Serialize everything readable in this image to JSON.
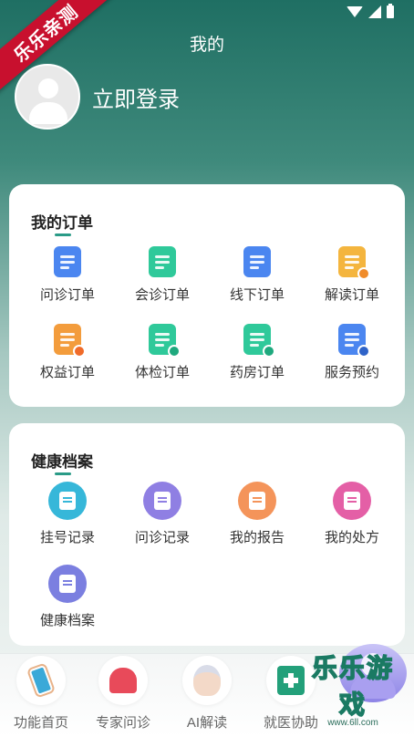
{
  "ribbon": "乐乐亲测",
  "page_title": "我的",
  "login_label": "立即登录",
  "orders": {
    "title": "我的订单",
    "items": [
      {
        "label": "问诊订单",
        "icon": "clipboard-icon",
        "color": "#4b86f0"
      },
      {
        "label": "会诊订单",
        "icon": "calendar-note-icon",
        "color": "#2fc99a"
      },
      {
        "label": "线下订单",
        "icon": "document-stack-icon",
        "color": "#4b86f0"
      },
      {
        "label": "解读订单",
        "icon": "chat-document-icon",
        "color": "#f4b53e"
      },
      {
        "label": "权益订单",
        "icon": "star-document-icon",
        "color": "#f39c3c"
      },
      {
        "label": "体检订单",
        "icon": "edit-document-icon",
        "color": "#2fc99a"
      },
      {
        "label": "药房订单",
        "icon": "pharmacy-document-icon",
        "color": "#2fc99a"
      },
      {
        "label": "服务预约",
        "icon": "calendar-clock-icon",
        "color": "#4b86f0"
      }
    ]
  },
  "health": {
    "title": "健康档案",
    "items": [
      {
        "label": "挂号记录",
        "icon": "registration-icon",
        "color": "#36b7d9"
      },
      {
        "label": "问诊记录",
        "icon": "consult-record-icon",
        "color": "#8f7fe3"
      },
      {
        "label": "我的报告",
        "icon": "report-icon",
        "color": "#f4945a"
      },
      {
        "label": "我的处方",
        "icon": "prescription-icon",
        "color": "#e45fa6"
      },
      {
        "label": "健康档案",
        "icon": "health-file-icon",
        "color": "#7b7fe0"
      }
    ]
  },
  "bottom_nav": [
    {
      "label": "功能首页",
      "icon": "phone-hand-icon"
    },
    {
      "label": "专家问诊",
      "icon": "stethoscope-heart-icon"
    },
    {
      "label": "AI解读",
      "icon": "nurse-avatar-icon"
    },
    {
      "label": "就医协助",
      "icon": "medical-kit-icon"
    }
  ],
  "watermark": {
    "big": "乐乐游戏",
    "small": "www.6ll.com"
  }
}
